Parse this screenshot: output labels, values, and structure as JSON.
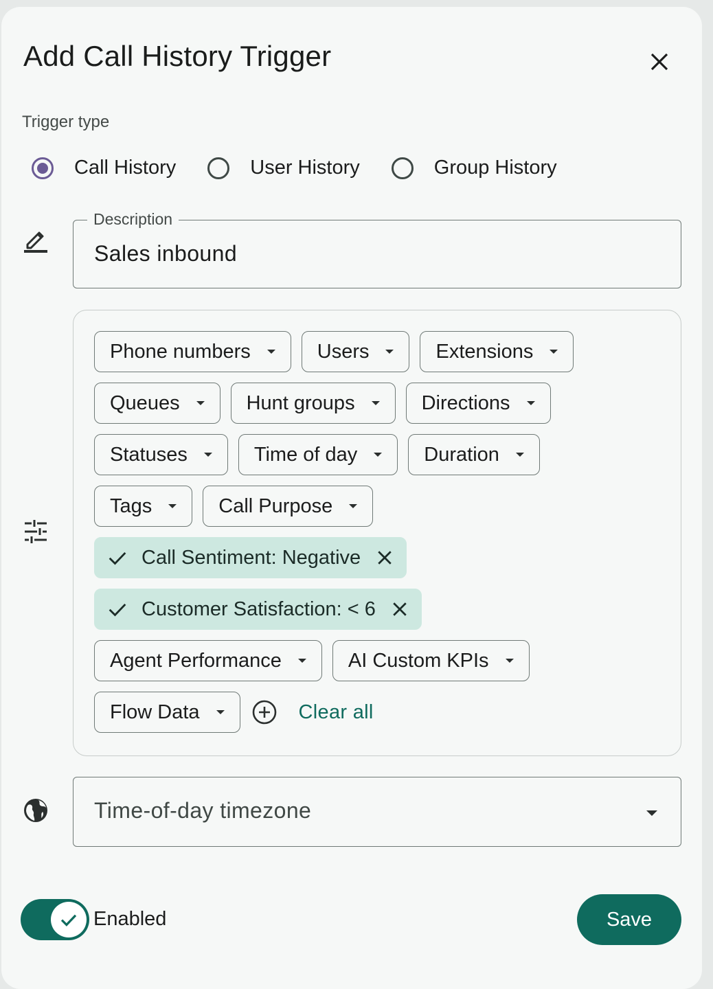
{
  "dialog": {
    "title": "Add Call History Trigger"
  },
  "trigger_type": {
    "label": "Trigger type",
    "options": [
      {
        "label": "Call History",
        "checked": true
      },
      {
        "label": "User History",
        "checked": false
      },
      {
        "label": "Group History",
        "checked": false
      }
    ]
  },
  "description": {
    "label": "Description",
    "value": "Sales inbound"
  },
  "filters": {
    "rows": [
      [
        {
          "label": "Phone numbers"
        },
        {
          "label": "Users"
        },
        {
          "label": "Extensions"
        }
      ],
      [
        {
          "label": "Queues"
        },
        {
          "label": "Hunt groups"
        },
        {
          "label": "Directions"
        }
      ],
      [
        {
          "label": "Statuses"
        },
        {
          "label": "Time of day"
        },
        {
          "label": "Duration"
        }
      ],
      [
        {
          "label": "Tags"
        },
        {
          "label": "Call Purpose"
        }
      ],
      [
        {
          "label": "Call Sentiment: Negative",
          "selected": true
        }
      ],
      [
        {
          "label": "Customer Satisfaction: < 6",
          "selected": true
        }
      ],
      [
        {
          "label": "Agent Performance"
        },
        {
          "label": "AI Custom KPIs"
        }
      ],
      [
        {
          "label": "Flow Data"
        }
      ]
    ],
    "clear_all": "Clear all"
  },
  "timezone": {
    "placeholder": "Time-of-day timezone"
  },
  "footer": {
    "enabled_label": "Enabled",
    "enabled": true,
    "save_label": "Save"
  },
  "colors": {
    "accent": "#0f6b5e",
    "radio_selected": "#6b5b95",
    "chip_selected_bg": "#cde8e0"
  },
  "icons": {
    "close": "close-icon",
    "description": "edit-pencil-icon",
    "filters": "tune-sliders-icon",
    "timezone": "globe-icon",
    "add": "add-circle-icon"
  }
}
